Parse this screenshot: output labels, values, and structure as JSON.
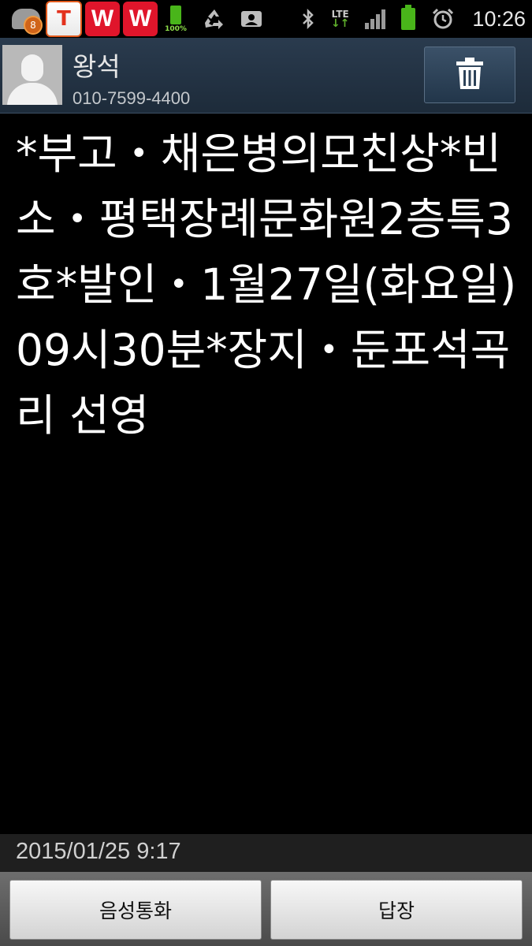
{
  "status_bar": {
    "notification_count": "8",
    "app_t_label": "T",
    "app_w1_label": "W",
    "app_w2_label": "W",
    "battery_small_pct": "100%",
    "network_label": "LTE",
    "time": "10:26",
    "icons": [
      "message-icon",
      "t-app-icon",
      "w-app-icon",
      "w-app-icon",
      "battery-small-icon",
      "recycle-icon",
      "voicemail-icon",
      "bluetooth-icon",
      "lte-icon",
      "signal-icon",
      "battery-icon",
      "alarm-icon"
    ],
    "colors": {
      "battery": "#49b51a",
      "badge": "#d0641a",
      "w_app": "#e0152b"
    }
  },
  "contact": {
    "name": "왕석",
    "number": "010-7599-4400"
  },
  "message": {
    "text": "*부고・채은병의모친상*빈소・평택장례문화원2층특3호*발인・1월27일(화요일)09시30분*장지・둔포석곡리 선영"
  },
  "footer": {
    "timestamp": "2015/01/25 9:17",
    "voice_call_label": "음성통화",
    "reply_label": "답장"
  }
}
